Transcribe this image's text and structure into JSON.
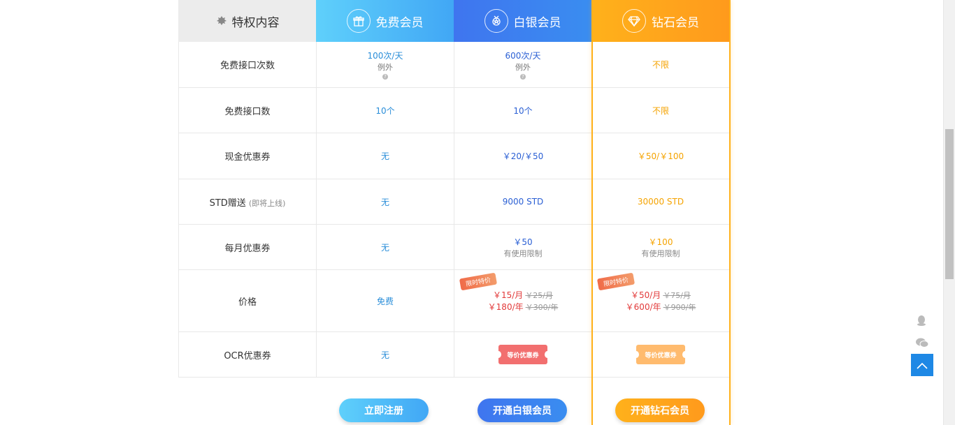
{
  "header": {
    "col0": "特权内容",
    "col1": "免费会员",
    "col2": "白银会员",
    "col3": "钻石会员",
    "icons": [
      "badge-icon",
      "gift-icon",
      "medal-icon",
      "diamond-icon"
    ]
  },
  "rows": [
    {
      "label": "免费接口次数",
      "free": "100次/天",
      "free_sub": "例外",
      "silver": "600次/天",
      "silver_sub": "例外",
      "diamond": "不限"
    },
    {
      "label": "免费接口数",
      "free": "10个",
      "silver": "10个",
      "diamond": "不限"
    },
    {
      "label": "现金优惠券",
      "free": "无",
      "silver": "￥20/￥50",
      "diamond": "￥50/￥100"
    },
    {
      "label": "STD赠送",
      "label_sub": "(即将上线)",
      "free": "无",
      "silver": "9000 STD",
      "diamond": "30000 STD"
    },
    {
      "label": "每月优惠券",
      "free": "无",
      "silver": "￥50",
      "silver_note": "有使用限制",
      "diamond": "￥100",
      "diamond_note": "有使用限制"
    },
    {
      "label": "价格",
      "free": "免费",
      "silver_promo": "限时特价",
      "silver_month": "￥15/月",
      "silver_month_old": "￥25/月",
      "silver_year": "￥180/年",
      "silver_year_old": "￥300/年",
      "diamond_promo": "限时特价",
      "diamond_month": "￥50/月",
      "diamond_month_old": "￥75/月",
      "diamond_year": "￥600/年",
      "diamond_year_old": "￥900/年"
    },
    {
      "label": "OCR优惠券",
      "free": "无",
      "silver_ticket": "等价优惠券",
      "diamond_ticket": "等价优惠券"
    }
  ],
  "buttons": {
    "register": "立即注册",
    "silver": "开通白银会员",
    "diamond": "开通钻石会员"
  },
  "colors": {
    "free": "#41a7f5",
    "silver": "#3f75ef",
    "diamond": "#ffb11b",
    "backtop": "#1e88e5"
  },
  "side": [
    "qq-icon",
    "wechat-icon",
    "back-to-top-icon"
  ]
}
